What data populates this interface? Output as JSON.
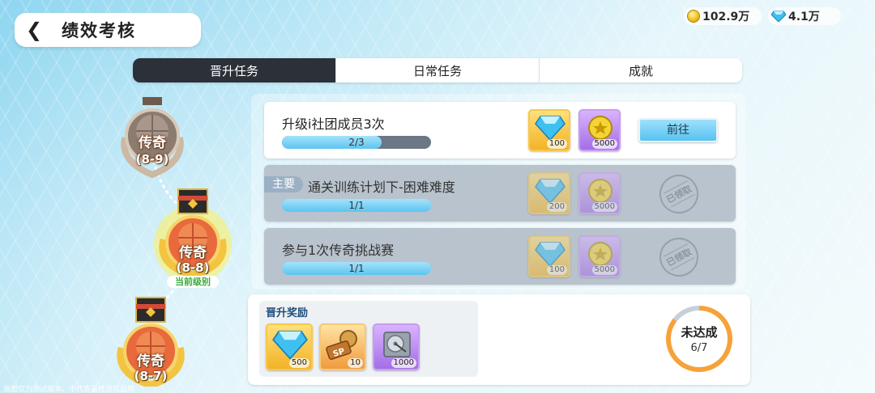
{
  "header": {
    "back_icon": "chevron-left-icon",
    "title": "绩效考核"
  },
  "currency": {
    "gold": "102.9万",
    "diamond": "4.1万"
  },
  "tabs": [
    {
      "label": "晋升任务",
      "active": true
    },
    {
      "label": "日常任务",
      "active": false
    },
    {
      "label": "成就",
      "active": false
    }
  ],
  "medals": [
    {
      "rank": "传奇",
      "level": "(8-9)"
    },
    {
      "rank": "传奇",
      "level": "(8-8)",
      "tag": "当前级别"
    },
    {
      "rank": "传奇",
      "level": "(8-7)"
    }
  ],
  "tasks": [
    {
      "name": "升级i社团成员3次",
      "progress_text": "2/3",
      "progress": 0.6667,
      "rewards": [
        "100",
        "5000"
      ],
      "action": "前往",
      "status": "active"
    },
    {
      "tag": "主要",
      "name": "通关训练计划下-困难难度",
      "progress_text": "1/1",
      "progress": 1,
      "rewards": [
        "200",
        "5000"
      ],
      "claimed_label": "已领取",
      "status": "claimed"
    },
    {
      "name": "参与1次传奇挑战赛",
      "progress_text": "1/1",
      "progress": 1,
      "rewards": [
        "100",
        "5000"
      ],
      "claimed_label": "已领取",
      "status": "claimed"
    }
  ],
  "promotion": {
    "title": "晋升奖励",
    "rewards": [
      {
        "icon": "diamond-icon",
        "count": "500"
      },
      {
        "icon": "sp-ticket-icon",
        "count": "10"
      },
      {
        "icon": "hard-drive-icon",
        "count": "1000"
      }
    ],
    "status": "未达成",
    "count_text": "6/7",
    "progress": 0.857
  },
  "footer_note": "画面仅为测试版本，不代表最终游戏品质",
  "colors": {
    "accent": "#56c3f1",
    "active_tab": "#2c3038",
    "ring": "#f6a23a"
  }
}
